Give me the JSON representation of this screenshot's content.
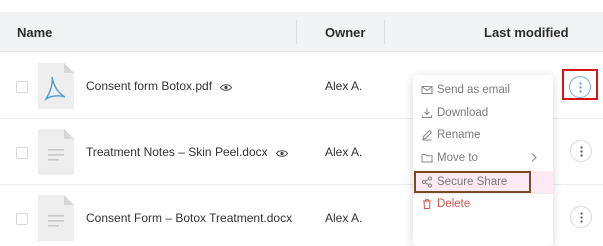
{
  "table": {
    "headers": {
      "name": "Name",
      "owner": "Owner",
      "last_modified": "Last modified"
    },
    "rows": [
      {
        "filename": "Consent form Botox.pdf",
        "owner": "Alex A.",
        "type": "pdf",
        "visibility_icon": "eye-icon"
      },
      {
        "filename": "Treatment Notes – Skin Peel.docx",
        "owner": "Alex A.",
        "type": "docx",
        "visibility_icon": "eye-icon"
      },
      {
        "filename": "Consent Form – Botox Treatment.docx",
        "owner": "Alex A.",
        "type": "docx"
      }
    ]
  },
  "context_menu": {
    "items": [
      {
        "label": "Send as email",
        "icon": "mail-icon"
      },
      {
        "label": "Download",
        "icon": "download-icon"
      },
      {
        "label": "Rename",
        "icon": "pencil-icon"
      },
      {
        "label": "Move to",
        "icon": "folder-icon"
      },
      {
        "label": "Secure Share",
        "icon": "share-icon"
      },
      {
        "label": "Delete",
        "icon": "trash-icon"
      }
    ]
  },
  "colors": {
    "header_bg": "#f2f3f4",
    "pdf_accent": "#4a9fd4",
    "delete_red": "#d9534f",
    "highlight_pink": "#fce9f3",
    "annotation_red": "#d81515",
    "annotation_brown": "#7a4a2a"
  }
}
